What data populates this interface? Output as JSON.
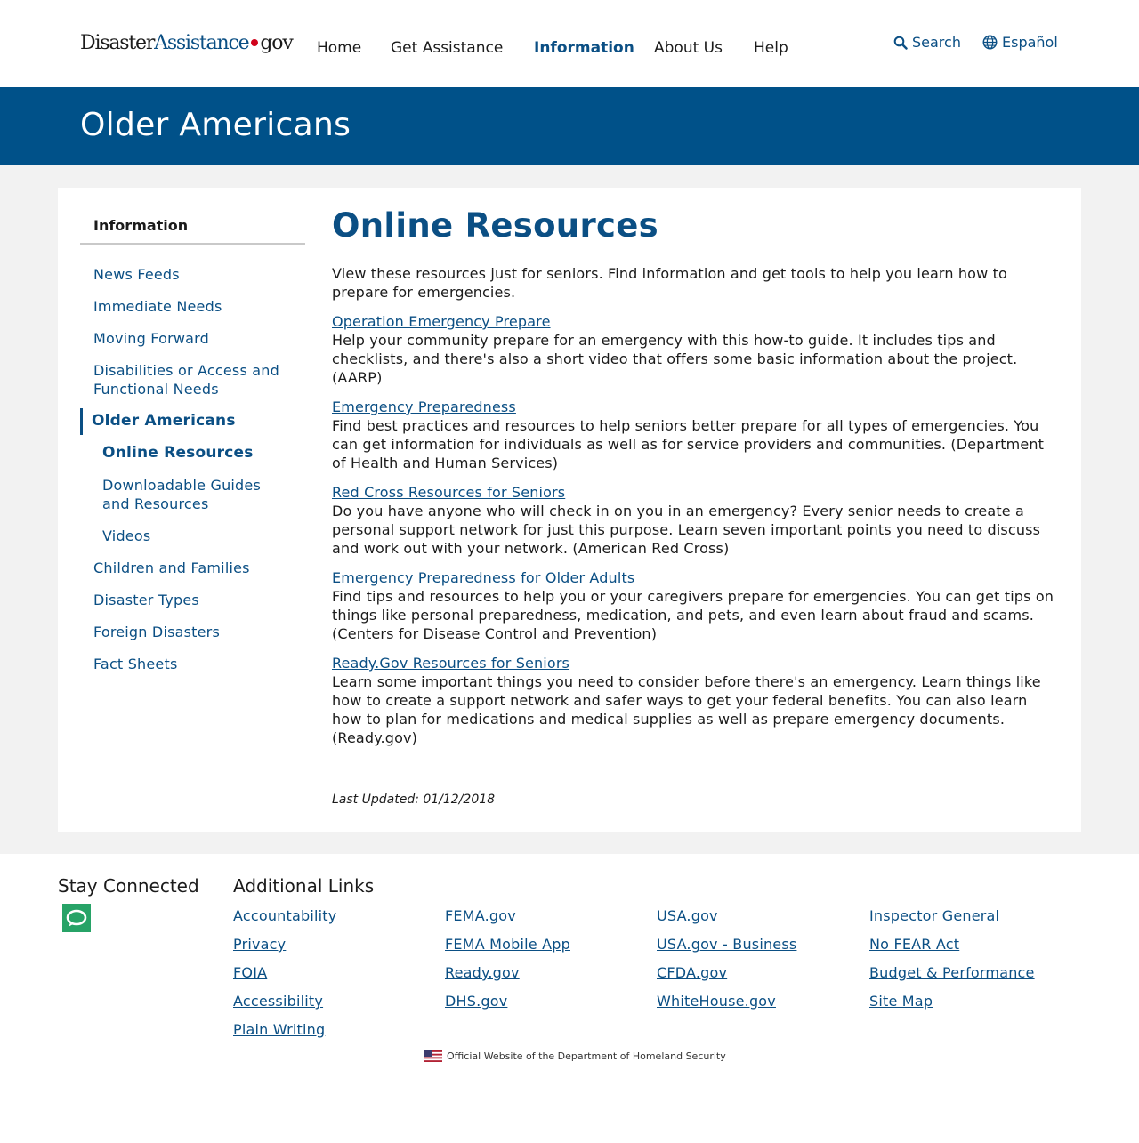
{
  "header": {
    "logo": {
      "part1": "Disaster",
      "part2": "Assistance",
      "part3": "gov"
    },
    "nav": [
      "Home",
      "Get Assistance",
      "Information",
      "About Us",
      "Help"
    ],
    "search_label": "Search",
    "language_label": "Español"
  },
  "banner": {
    "title": "Older Americans"
  },
  "sidebar": {
    "heading": "Information",
    "items": [
      "News Feeds",
      "Immediate Needs",
      "Moving Forward",
      "Disabilities or Access and Functional Needs",
      "Older Americans",
      "Online Resources",
      "Downloadable Guides and Resources",
      "Videos",
      "Children and Families",
      "Disaster Types",
      "Foreign Disasters",
      "Fact Sheets"
    ]
  },
  "main": {
    "title": "Online Resources",
    "intro": "View these resources just for seniors. Find information and get tools to help you learn how to prepare for emergencies.",
    "resources": [
      {
        "title": "Operation Emergency Prepare",
        "desc": "Help your community prepare for an emergency with this how-to guide. It includes tips and checklists, and there's also a short video that offers some basic information about the project. (AARP)"
      },
      {
        "title": "Emergency Preparedness",
        "desc": "Find best practices and resources to help seniors better prepare for all types of emergencies. You can get information for individuals as well as for service providers and communities. (Department of Health and Human Services)"
      },
      {
        "title": "Red Cross Resources for Seniors",
        "desc": "Do you have anyone who will check in on you in an emergency? Every senior needs to create a personal support network for just this purpose. Learn seven important points you need to discuss and work out with your network. (American Red Cross)"
      },
      {
        "title": "Emergency Preparedness for Older Adults",
        "desc": "Find tips and resources to help you or your caregivers prepare for emergencies. You can get tips on things like personal preparedness, medication, and pets, and even learn about fraud and scams. (Centers for Disease Control and Prevention)"
      },
      {
        "title": "Ready.Gov Resources for Seniors",
        "desc": "Learn some important things you need to consider before there's an emergency. Learn things like how to create a support network and safer ways to get your federal benefits. You can also learn how to plan for medications and medical supplies as well as prepare emergency documents. (Ready.gov)"
      }
    ],
    "last_updated": "Last Updated: 01/12/2018"
  },
  "footer": {
    "stay_connected": "Stay Connected",
    "additional_links": "Additional Links",
    "links": [
      [
        "Accountability",
        "Privacy",
        "FOIA",
        "Accessibility",
        "Plain Writing"
      ],
      [
        "FEMA.gov",
        "FEMA Mobile App",
        "Ready.gov",
        "DHS.gov"
      ],
      [
        "USA.gov",
        "USA.gov - Business",
        "CFDA.gov",
        "WhiteHouse.gov"
      ],
      [
        "Inspector General",
        "No FEAR Act",
        "Budget & Performance",
        "Site Map"
      ]
    ],
    "official": "Official Website of the Department of Homeland Security"
  },
  "colors": {
    "brand_blue": "#005189",
    "link_blue": "#0b4f84",
    "chat_green": "#27a367",
    "logo_dot_red": "#d0021b"
  }
}
